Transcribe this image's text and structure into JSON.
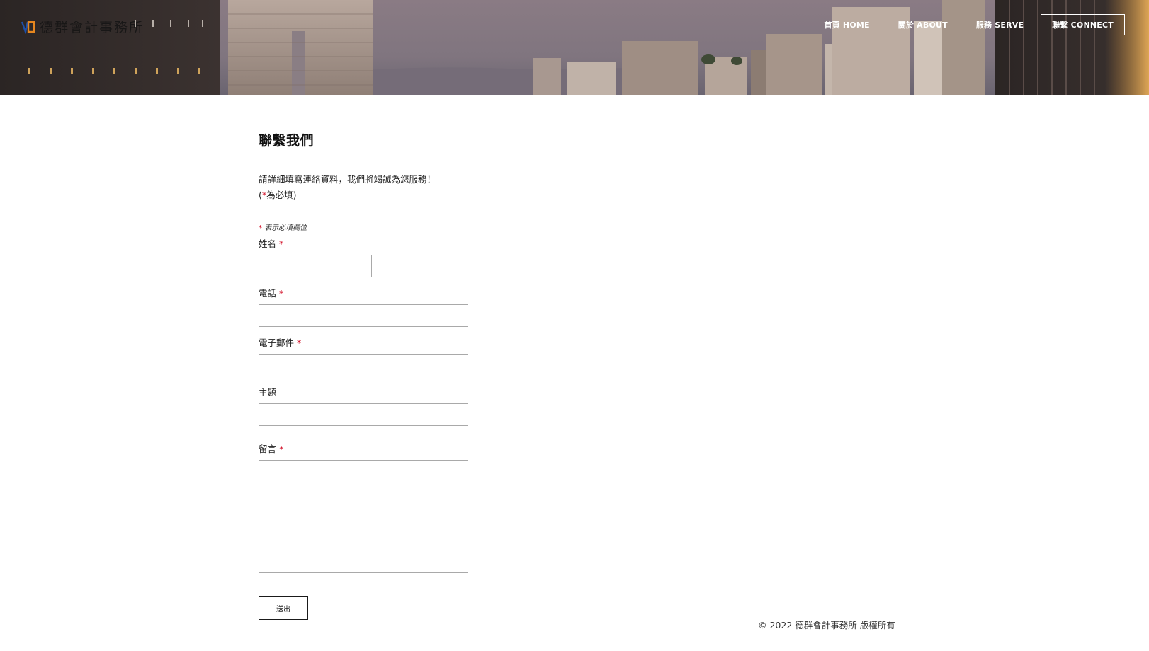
{
  "header": {
    "logo_text": "德群會計事務所",
    "nav": [
      {
        "label": "首頁 HOME"
      },
      {
        "label": "關於 ABOUT"
      },
      {
        "label": "服務 SERVE"
      },
      {
        "label": "聯繫 CONNECT"
      }
    ]
  },
  "form": {
    "title": "聯繫我們",
    "intro_line1": "請詳細填寫連絡資料，我們將竭誠為您服務！",
    "intro_line2_open": "(",
    "intro_line2_star": "*",
    "intro_line2_rest": "為必填)",
    "required_note_star": "*",
    "required_note_text": "表示必填欄位",
    "fields": {
      "name": {
        "label": "姓名",
        "required": "*",
        "value": ""
      },
      "phone": {
        "label": "電話",
        "required": "*",
        "value": ""
      },
      "email": {
        "label": "電子郵件",
        "required": "*",
        "value": ""
      },
      "subject": {
        "label": "主題",
        "value": ""
      },
      "message": {
        "label": "留言",
        "required": "*",
        "value": ""
      }
    },
    "submit_label": "送出"
  },
  "footer": {
    "copyright": "© 2022 德群會計事務所 版權所有"
  },
  "colors": {
    "required_star": "#d0021b",
    "nav_text": "#ffffff"
  }
}
